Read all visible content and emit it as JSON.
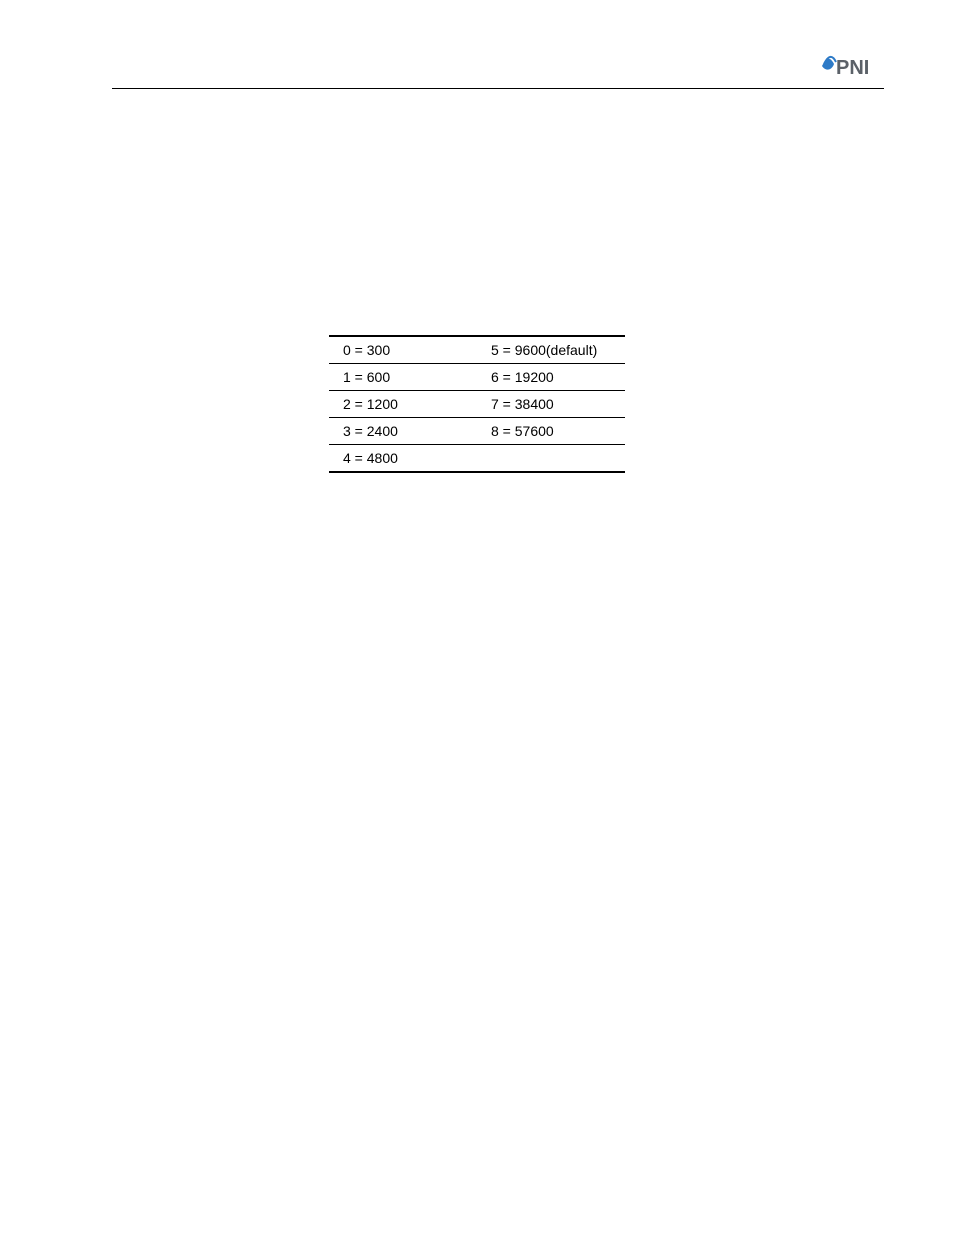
{
  "brand": "PNI",
  "table": {
    "rows": [
      {
        "left": "0 = 300",
        "right": "5 = 9600(default)"
      },
      {
        "left": "1 = 600",
        "right": "6 = 19200"
      },
      {
        "left": "2 = 1200",
        "right": "7 = 38400"
      },
      {
        "left": "3 = 2400",
        "right": "8 = 57600"
      },
      {
        "left": "4 = 4800",
        "right": ""
      }
    ]
  },
  "footer": {
    "url": ""
  }
}
